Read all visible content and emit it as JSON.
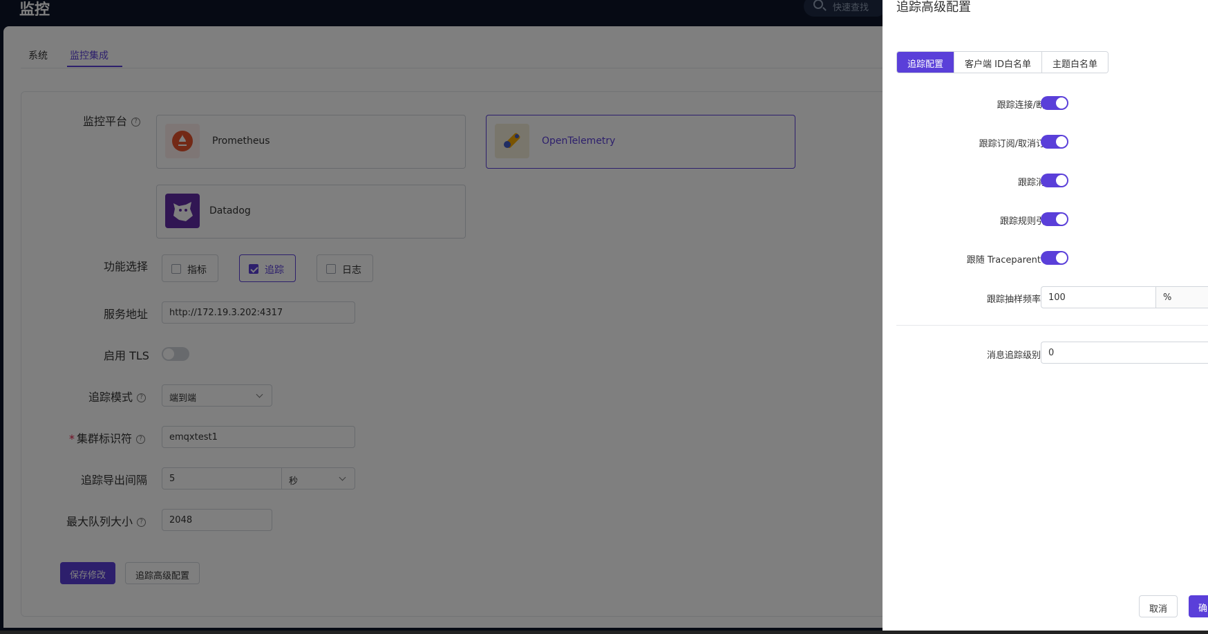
{
  "app": {
    "title": "监控",
    "search_placeholder": "快速查找"
  },
  "tabs": [
    {
      "label": "系统",
      "active": false
    },
    {
      "label": "监控集成",
      "active": true
    }
  ],
  "form": {
    "platform_label": "监控平台",
    "platforms": [
      {
        "name": "Prometheus",
        "selected": false
      },
      {
        "name": "OpenTelemetry",
        "selected": true
      },
      {
        "name": "Datadog",
        "selected": false
      }
    ],
    "features_label": "功能选择",
    "features": [
      {
        "label": "指标",
        "checked": false
      },
      {
        "label": "追踪",
        "checked": true
      },
      {
        "label": "日志",
        "checked": false
      }
    ],
    "endpoint_label": "服务地址",
    "endpoint_value": "http://172.19.3.202:4317",
    "tls_label": "启用 TLS",
    "tls_enabled": false,
    "trace_mode_label": "追踪模式",
    "trace_mode_value": "端到端",
    "cluster_id_label": "集群标识符",
    "cluster_id_value": "emqxtest1",
    "export_interval_label": "追踪导出间隔",
    "export_interval_value": "5",
    "export_interval_unit": "秒",
    "max_queue_label": "最大队列大小",
    "max_queue_value": "2048",
    "save_button": "保存修改",
    "advanced_button": "追踪高级配置"
  },
  "drawer": {
    "title": "追踪高级配置",
    "tabs": [
      {
        "label": "追踪配置",
        "active": true
      },
      {
        "label": "客户端 ID白名单",
        "active": false
      },
      {
        "label": "主题白名单",
        "active": false
      }
    ],
    "toggles": [
      {
        "label": "跟踪连接/断开",
        "on": true
      },
      {
        "label": "跟踪订阅/取消订阅",
        "on": true
      },
      {
        "label": "跟踪消息",
        "on": true
      },
      {
        "label": "跟踪规则引擎",
        "on": true
      },
      {
        "label": "跟随 Traceparent",
        "on": true
      }
    ],
    "sample_rate_label": "跟踪抽样频率",
    "sample_rate_value": "100",
    "sample_rate_unit": "%",
    "msg_trace_level_label": "消息追踪级别",
    "msg_trace_level_value": "0",
    "cancel_button": "取消",
    "confirm_button": "确"
  },
  "colors": {
    "primary": "#5a3fd9",
    "header_bg": "#0c1528"
  }
}
